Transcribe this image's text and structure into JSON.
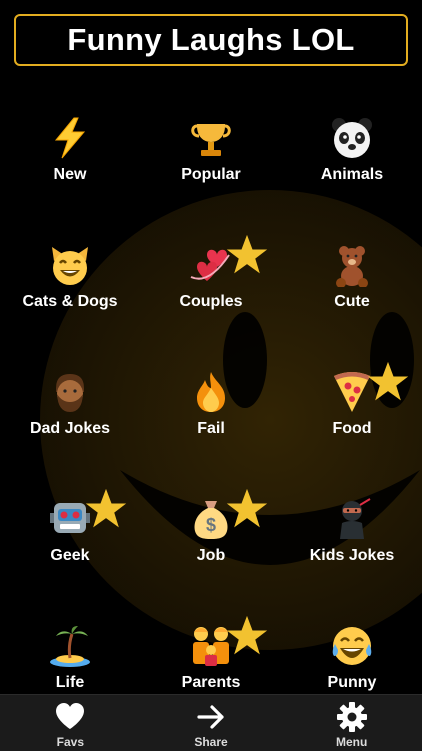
{
  "header": {
    "title": "Funny Laughs LOL"
  },
  "categories": [
    {
      "label": "New",
      "icon": "lightning-icon",
      "starred": false
    },
    {
      "label": "Popular",
      "icon": "trophy-icon",
      "starred": false
    },
    {
      "label": "Animals",
      "icon": "panda-icon",
      "starred": false
    },
    {
      "label": "Cats & Dogs",
      "icon": "smiling-cat-icon",
      "starred": false
    },
    {
      "label": "Couples",
      "icon": "hearts-icon",
      "starred": true
    },
    {
      "label": "Cute",
      "icon": "teddy-bear-icon",
      "starred": false
    },
    {
      "label": "Dad Jokes",
      "icon": "bearded-man-icon",
      "starred": false
    },
    {
      "label": "Fail",
      "icon": "fire-icon",
      "starred": false
    },
    {
      "label": "Food",
      "icon": "pizza-icon",
      "starred": true
    },
    {
      "label": "Geek",
      "icon": "robot-icon",
      "starred": true
    },
    {
      "label": "Job",
      "icon": "money-bag-icon",
      "starred": true
    },
    {
      "label": "Kids Jokes",
      "icon": "ninja-icon",
      "starred": false
    },
    {
      "label": "Life",
      "icon": "island-icon",
      "starred": false
    },
    {
      "label": "Parents",
      "icon": "family-icon",
      "starred": true
    },
    {
      "label": "Punny",
      "icon": "tears-of-joy-icon",
      "starred": false
    }
  ],
  "tabbar": {
    "items": [
      {
        "label": "Favs",
        "icon": "heart-icon"
      },
      {
        "label": "Share",
        "icon": "arrow-right-icon"
      },
      {
        "label": "Menu",
        "icon": "gear-icon"
      }
    ]
  },
  "colors": {
    "accent": "#e3ad20",
    "background": "#000000",
    "tabbar": "#1b1b1b",
    "star": "#f2c230"
  }
}
